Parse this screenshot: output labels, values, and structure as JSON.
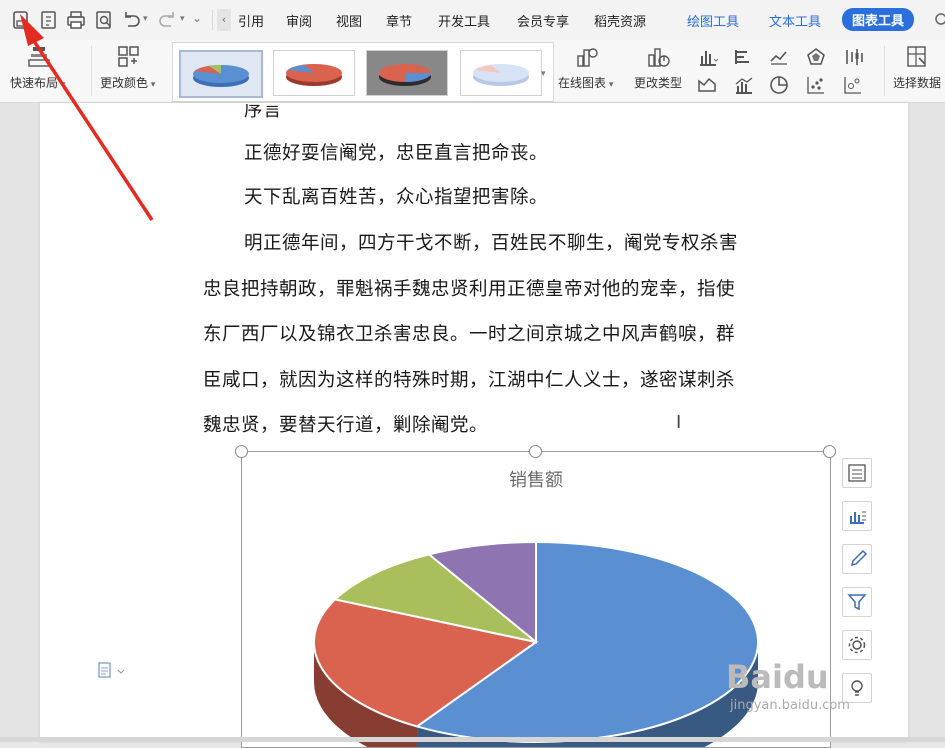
{
  "menu": {
    "items": [
      {
        "label": "引用",
        "key": "ref"
      },
      {
        "label": "审阅",
        "key": "review"
      },
      {
        "label": "视图",
        "key": "view"
      },
      {
        "label": "章节",
        "key": "section"
      },
      {
        "label": "开发工具",
        "key": "dev"
      },
      {
        "label": "会员专享",
        "key": "vip"
      },
      {
        "label": "稻壳资源",
        "key": "docer"
      }
    ],
    "context_tabs": [
      {
        "label": "绘图工具",
        "key": "draw"
      },
      {
        "label": "文本工具",
        "key": "text"
      }
    ],
    "active_tab": "图表工具"
  },
  "ribbon": {
    "quick_layout": "快速布局",
    "change_color": "更改颜色",
    "online_chart": "在线图表",
    "change_type": "更改类型",
    "select_data": "选择数据"
  },
  "document": {
    "partial_top": "序言",
    "lines": [
      "正德好耍信阉党，忠臣直言把命丧。",
      "天下乱离百姓苦，众心指望把害除。",
      "明正德年间，四方干戈不断，百姓民不聊生，阉党专权杀害",
      "忠良把持朝政，罪魁祸手魏忠贤利用正德皇帝对他的宠幸，指使",
      "东厂西厂以及锦衣卫杀害忠良。一时之间京城之中风声鹤唳，群",
      "臣咸口，就因为这样的特殊时期，江湖中仁人义士，遂密谋刺杀",
      "魏忠贤，要替天行道，剿除阉党。"
    ]
  },
  "chart_data": {
    "type": "pie",
    "style": "3d",
    "title": "销售额",
    "series": [
      {
        "values": [
          59,
          23,
          10,
          8
        ],
        "colors": [
          "#5a8fd2",
          "#d9634f",
          "#a8bf5b",
          "#8e74b0"
        ]
      }
    ]
  },
  "watermark": {
    "brand": "Baidu",
    "site": "jingyan.baidu.com"
  }
}
